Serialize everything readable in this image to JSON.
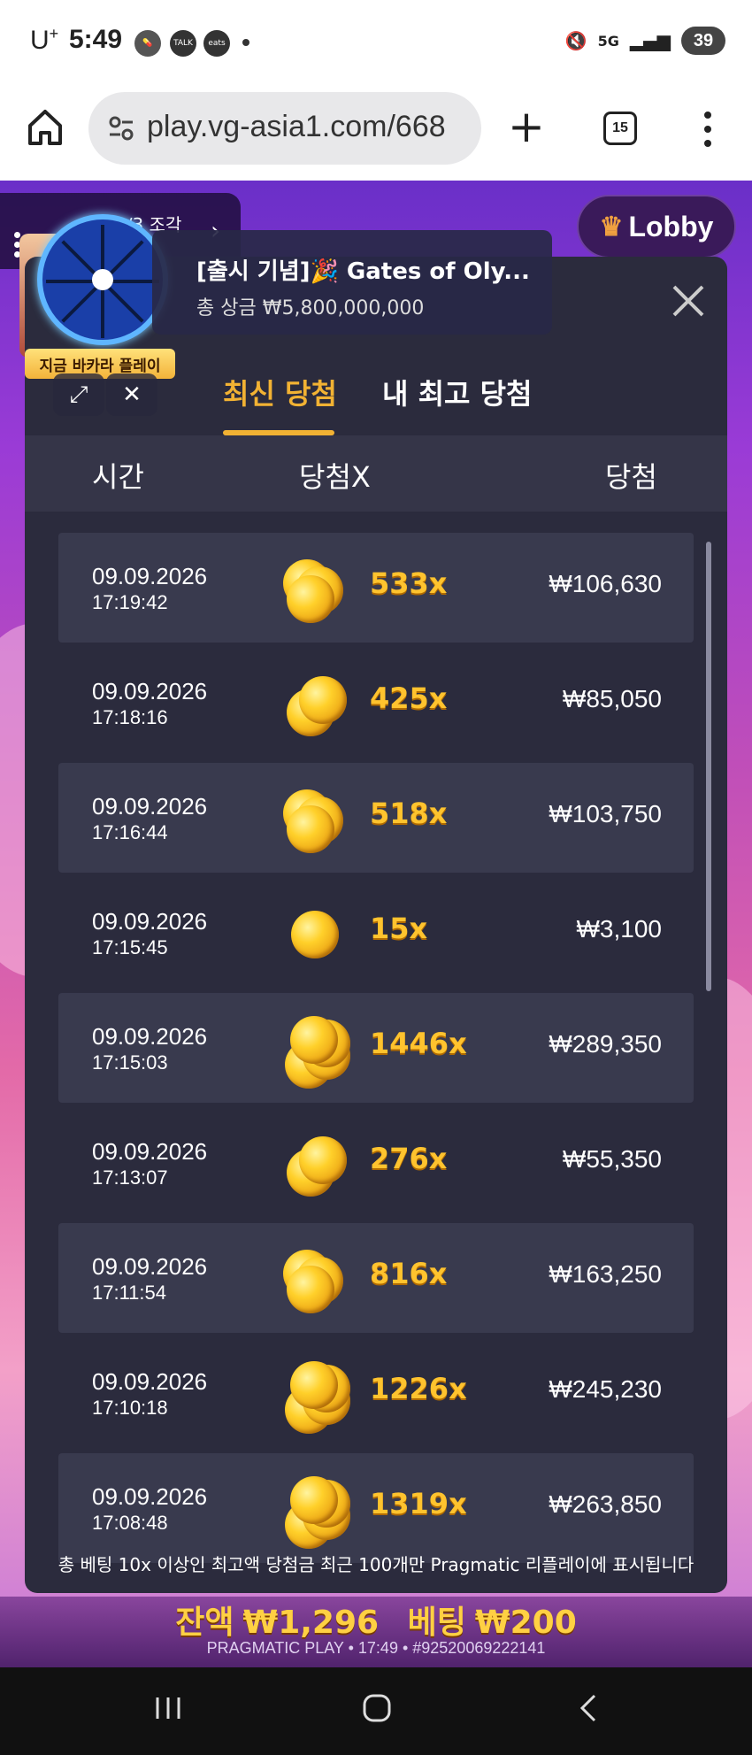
{
  "status_bar": {
    "carrier": "U",
    "carrier_sup": "+",
    "time": "5:49",
    "icons": [
      "pill-icon",
      "kakaotalk-icon",
      "coupang-eats-icon",
      "dot"
    ],
    "talk_label": "TALK",
    "eats_label": "eats",
    "network": "5G",
    "battery": "39"
  },
  "browser": {
    "url": "play.vg-asia1.com/668",
    "tab_count": "15"
  },
  "game": {
    "lobby_label": "Lobby",
    "pieces_label": "2/3 조각",
    "baccarat_tag": "지금 바카라 플레이",
    "promo": {
      "title": "[출시 기념]🎉 Gates of Oly...",
      "subtitle": "총 상금 ₩5,800,000,000"
    },
    "modal": {
      "tabs": [
        "최신 당첨",
        "내 최고 당첨"
      ],
      "active_tab": 0,
      "columns": [
        "시간",
        "당첨X",
        "당첨"
      ],
      "rows": [
        {
          "date": "09.09.2026",
          "time": "17:19:42",
          "mult": "533x",
          "win": "₩106,630",
          "coins": 3
        },
        {
          "date": "09.09.2026",
          "time": "17:18:16",
          "mult": "425x",
          "win": "₩85,050",
          "coins": 2
        },
        {
          "date": "09.09.2026",
          "time": "17:16:44",
          "mult": "518x",
          "win": "₩103,750",
          "coins": 3
        },
        {
          "date": "09.09.2026",
          "time": "17:15:45",
          "mult": "15x",
          "win": "₩3,100",
          "coins": 1
        },
        {
          "date": "09.09.2026",
          "time": "17:15:03",
          "mult": "1446x",
          "win": "₩289,350",
          "coins": 4
        },
        {
          "date": "09.09.2026",
          "time": "17:13:07",
          "mult": "276x",
          "win": "₩55,350",
          "coins": 2
        },
        {
          "date": "09.09.2026",
          "time": "17:11:54",
          "mult": "816x",
          "win": "₩163,250",
          "coins": 3
        },
        {
          "date": "09.09.2026",
          "time": "17:10:18",
          "mult": "1226x",
          "win": "₩245,230",
          "coins": 4
        },
        {
          "date": "09.09.2026",
          "time": "17:08:48",
          "mult": "1319x",
          "win": "₩263,850",
          "coins": 4
        }
      ]
    },
    "footer_note": "총 베팅 10x 이상인 최고액 당첨금 최근 100개만 Pragmatic 리플레이에 표시됩니다",
    "balance_label": "잔액",
    "balance_value": "₩1,296",
    "bet_label": "베팅",
    "bet_value": "₩200",
    "brand_line": "PRAGMATIC PLAY • 17:49 • #92520069222141"
  },
  "colors": {
    "accent": "#f2b233",
    "modal_bg": "#2b2b3d",
    "row_alt": "#393a4e"
  }
}
